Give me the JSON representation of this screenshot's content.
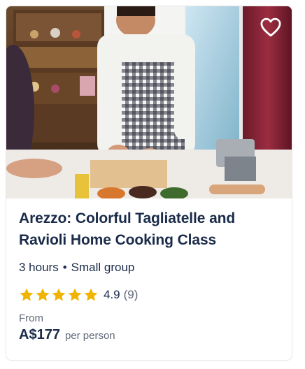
{
  "card": {
    "title": "Arezzo: Colorful Tagliatelle and Ravioli Home Cooking Class",
    "duration": "3 hours",
    "separator": "•",
    "group_size": "Small group",
    "rating": {
      "score": "4.9",
      "reviews": "(9)",
      "stars": 5,
      "star_color": "#f0b400"
    },
    "price_prefix": "From",
    "price": "A$177",
    "price_unit": "per person",
    "wishlist_icon": "heart-outline-icon",
    "colors": {
      "title": "#1a2b49",
      "muted": "#63687a"
    }
  }
}
